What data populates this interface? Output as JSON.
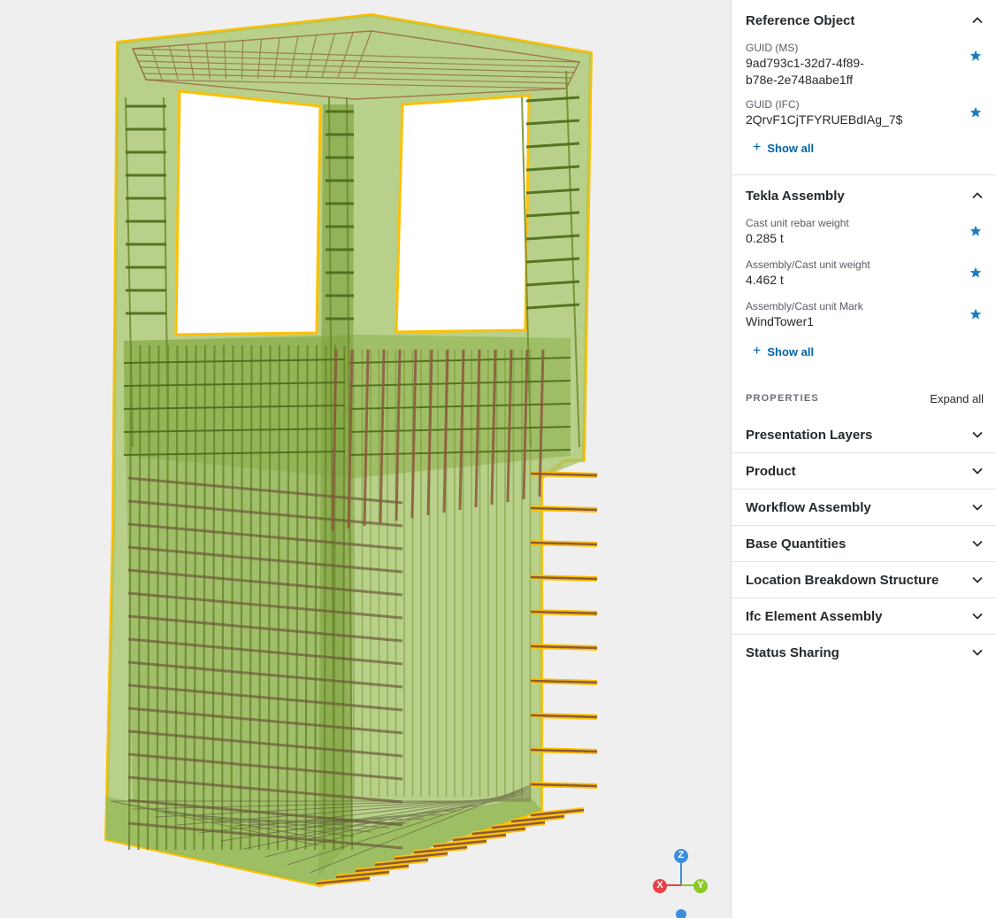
{
  "reference_object": {
    "title": "Reference Object",
    "fields": [
      {
        "label": "GUID (MS)",
        "value_line1": "9ad793c1-32d7-4f89-",
        "value_line2": "b78e-2e748aabe1ff"
      },
      {
        "label": "GUID (IFC)",
        "value": "2QrvF1CjTFYRUEBdIAg_7$"
      }
    ],
    "show_all": "Show all"
  },
  "tekla_assembly": {
    "title": "Tekla Assembly",
    "fields": [
      {
        "label": "Cast unit rebar weight",
        "value": "0.285 t"
      },
      {
        "label": "Assembly/Cast unit weight",
        "value": "4.462 t"
      },
      {
        "label": "Assembly/Cast unit Mark",
        "value": "WindTower1"
      }
    ],
    "show_all": "Show all"
  },
  "properties": {
    "heading": "PROPERTIES",
    "expand_all": "Expand all",
    "groups": [
      "Presentation Layers",
      "Product",
      "Workflow Assembly",
      "Base Quantities",
      "Location Breakdown Structure",
      "Ifc Element Assembly",
      "Status Sharing"
    ]
  },
  "axis_gizmo": {
    "z": "Z",
    "x": "X",
    "y": "Y"
  },
  "colors": {
    "accent_blue": "#0063a3",
    "star_blue": "#1a7fc1",
    "concrete_green": "#8db83a",
    "selection_yellow": "#ffc000",
    "rebar_brown": "#8b5a3c",
    "axis_x": "#e8414a",
    "axis_y": "#8ac926",
    "axis_z": "#3e8ede"
  }
}
